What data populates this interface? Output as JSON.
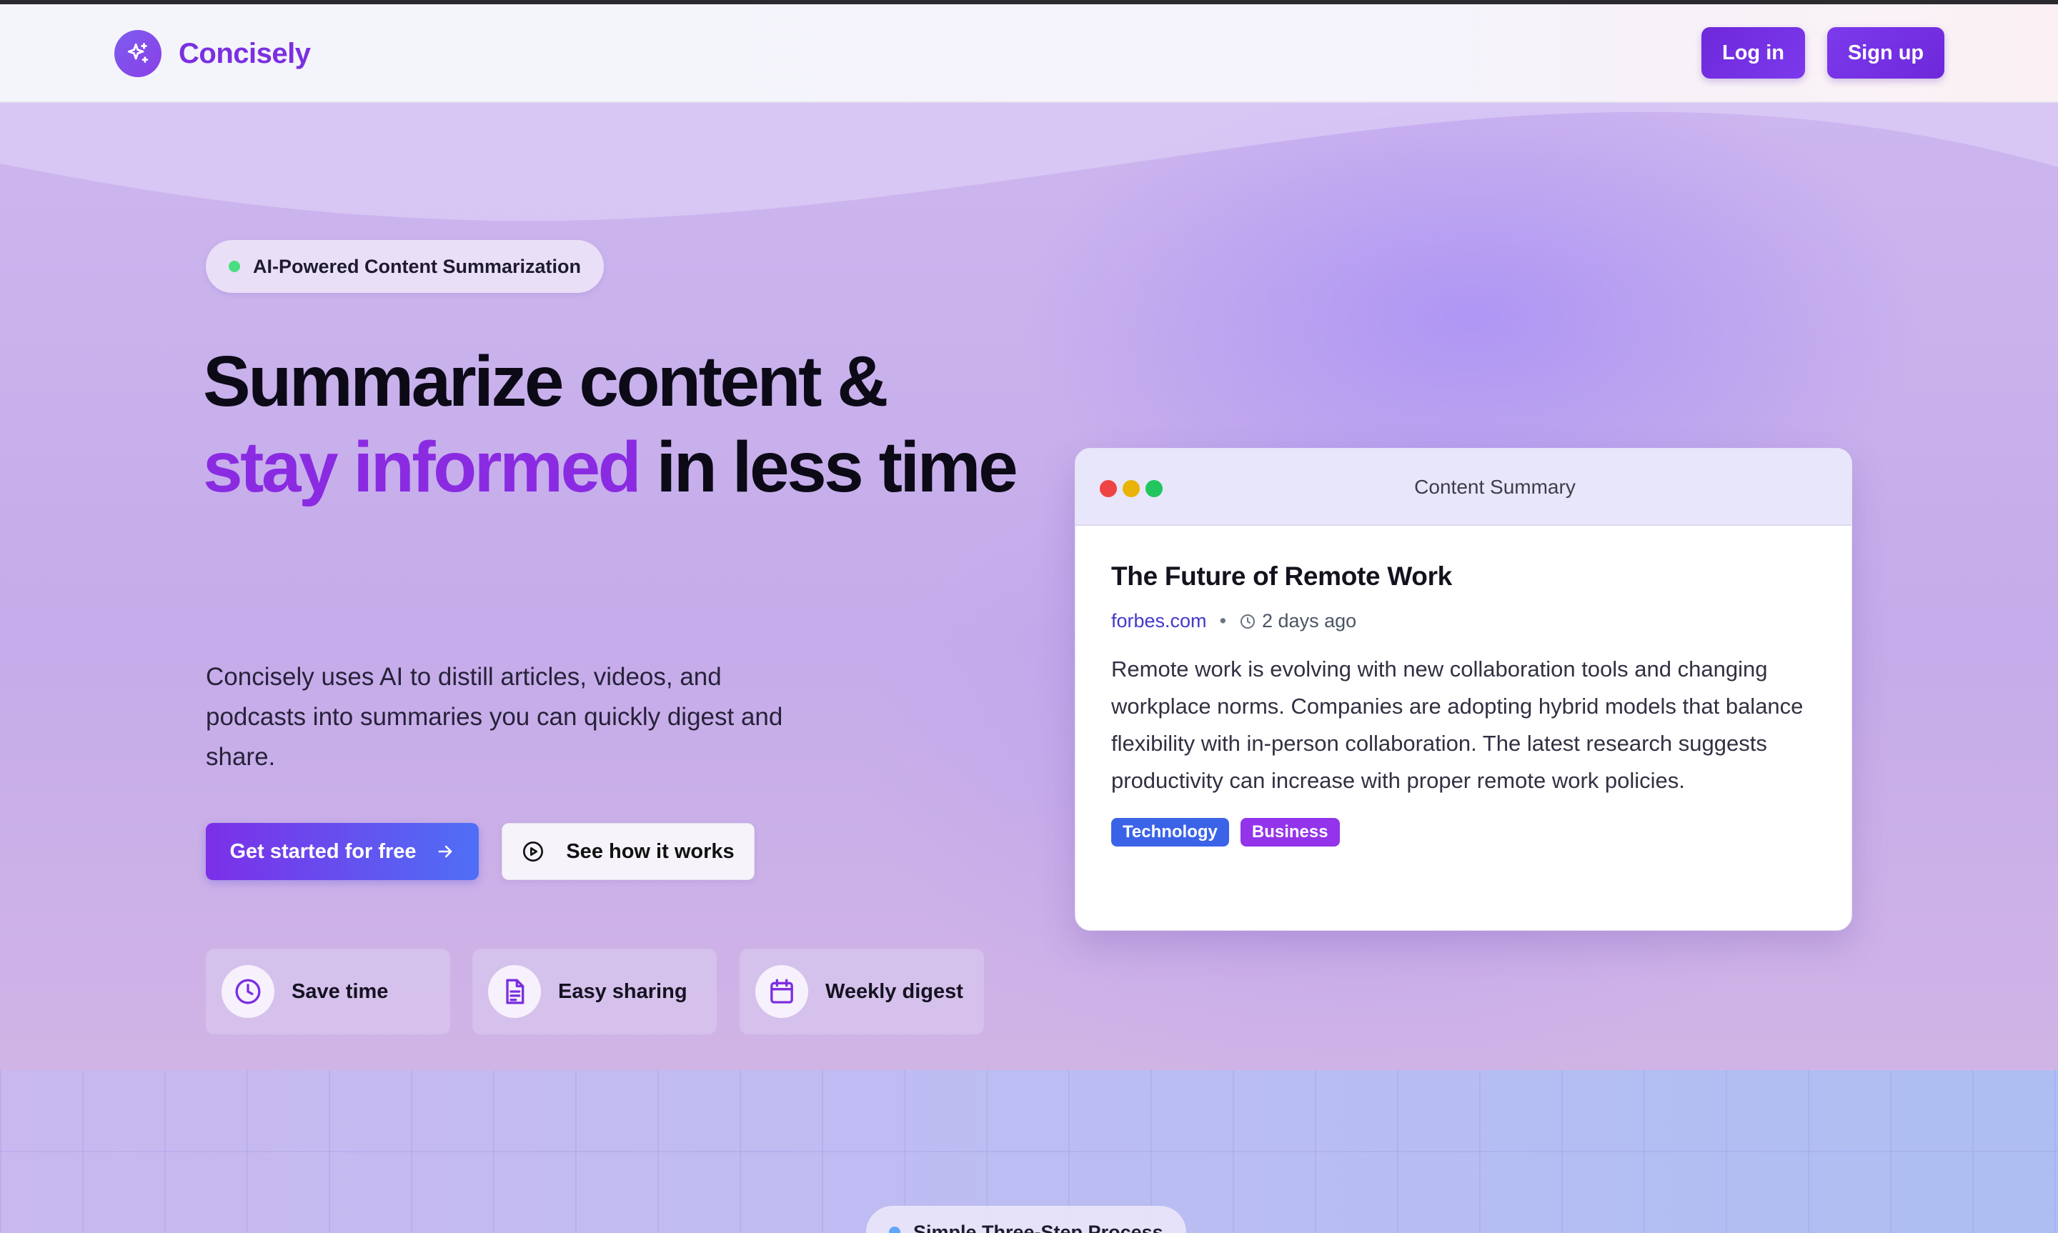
{
  "navbar": {
    "brand_name": "Concisely",
    "brand_icon": "sparkles-icon",
    "login_label": "Log in",
    "signup_label": "Sign up"
  },
  "hero": {
    "badge": "AI-Powered Content Summarization",
    "headline_line1": "Summarize content &",
    "headline_accent": "stay informed",
    "headline_rest": "in less time",
    "subtitle": "Concisely uses AI to distill articles, videos, and podcasts into summaries you can quickly digest and share.",
    "cta_primary": "Get started for free",
    "cta_secondary": "See how it works",
    "features": [
      {
        "label": "Save time",
        "icon": "clock-icon"
      },
      {
        "label": "Easy sharing",
        "icon": "document-icon"
      },
      {
        "label": "Weekly digest",
        "icon": "calendar-icon"
      }
    ]
  },
  "summary_card": {
    "window_title": "Content Summary",
    "article_title": "The Future of Remote Work",
    "source": "forbes.com",
    "separator": "•",
    "time_ago": "2 days ago",
    "summary": "Remote work is evolving with new collaboration tools and changing workplace norms. Companies are adopting hybrid models that balance flexibility with in-person collaboration. The latest research suggests productivity can increase with proper remote work policies.",
    "tags": [
      "Technology",
      "Business"
    ]
  },
  "process": {
    "badge": "Simple Three-Step Process"
  },
  "colors": {
    "brand_purple": "#7a2fe0",
    "accent_purple": "#8a2be2",
    "button_purple": "#6d28d9",
    "tag_blue": "#3b63e8",
    "tag_purple": "#9333ea"
  }
}
